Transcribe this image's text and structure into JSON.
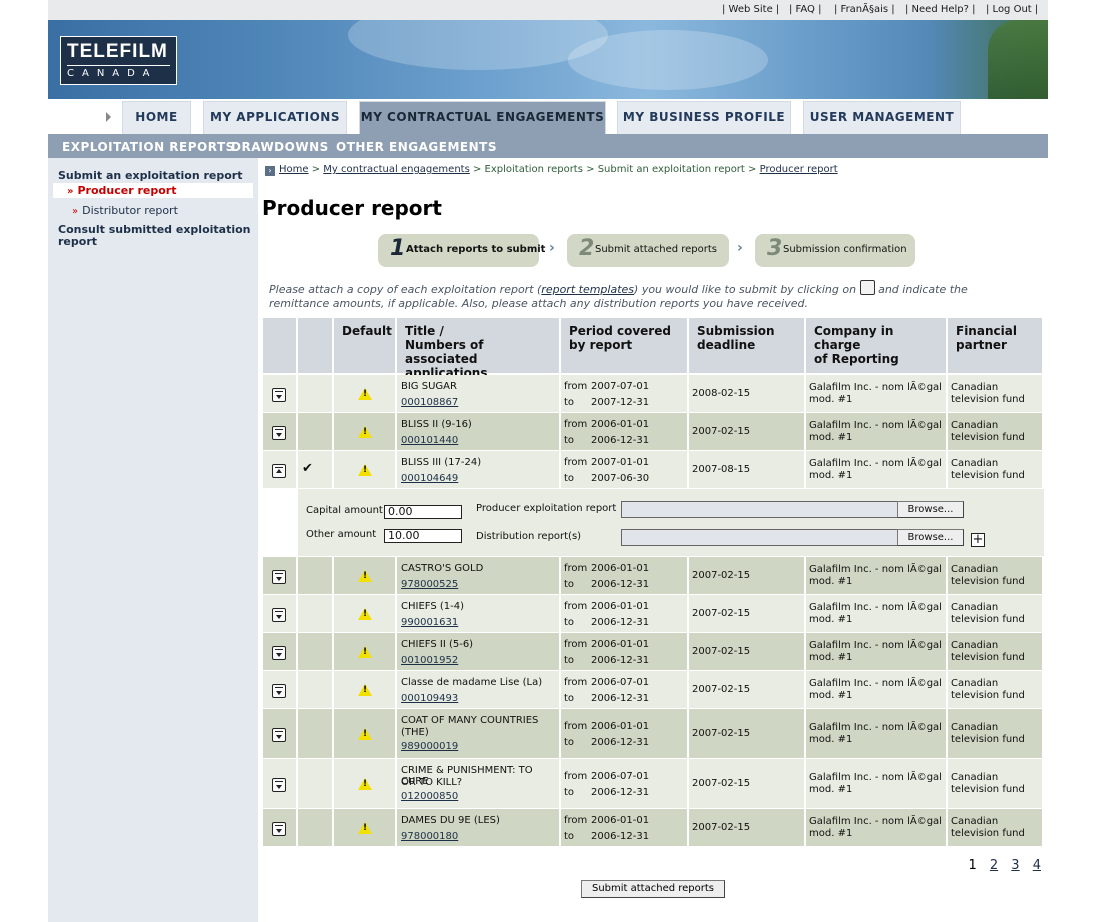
{
  "util_nav": {
    "web_site": "| Web Site |",
    "faq": "| FAQ |",
    "francais": "| FranÃ§ais |",
    "need_help": "| Need Help? |",
    "log_out": "| Log Out |"
  },
  "logo": {
    "line1": "TELEFILM",
    "line2": "CANADA"
  },
  "main_nav": {
    "home": "HOME",
    "my_applications": "MY APPLICATIONS",
    "my_contractual_engagements": "MY CONTRACTUAL ENGAGEMENTS",
    "my_business_profile": "MY BUSINESS PROFILE",
    "user_management": "USER MANAGEMENT",
    "active": "MY CONTRACTUAL ENGAGEMENTS"
  },
  "sub_nav": {
    "exploitation_reports": "EXPLOITATION REPORTS",
    "drawdowns": "DRAWDOWNS",
    "other_engagements": "OTHER ENGAGEMENTS"
  },
  "sidebar": {
    "submit_heading": "Submit an exploitation report",
    "producer_report": "Producer report",
    "distributor_report": "Distributor report",
    "consult_line1": "Consult submitted exploitation",
    "consult_line2": "report",
    "marker": "»"
  },
  "breadcrumb": {
    "home": "Home",
    "sep": " > ",
    "contractual": "My contractual engagements",
    "exploitation": "Exploitation reports",
    "submit": "Submit an exploitation report",
    "producer": "Producer report"
  },
  "page_title": "Producer report",
  "steps": [
    {
      "num": "1",
      "label": "Attach reports to submit"
    },
    {
      "num": "2",
      "label": "Submit attached reports"
    },
    {
      "num": "3",
      "label": "Submission confirmation"
    }
  ],
  "step_separator": "›",
  "intro": {
    "part1": "Please attach a copy of each exploitation report (",
    "link": "report templates",
    "part2": ") you would like to submit by clicking on",
    "part3": "and indicate the",
    "line2": "remittance amounts, if applicable. Also, please attach any distribution reports you have received."
  },
  "columns": {
    "default": "Default",
    "title_l1": "Title /",
    "title_l2": "Numbers of associated",
    "title_l3": "applications",
    "period_l1": "Period covered",
    "period_l2": "by report",
    "deadline_l1": "Submission",
    "deadline_l2": "deadline",
    "company_l1": "Company in charge",
    "company_l2": "of Reporting",
    "partner_l1": "Financial",
    "partner_l2": "partner"
  },
  "labels": {
    "from": "from",
    "to": "to",
    "warn_glyph": "!",
    "check_glyph": "✔"
  },
  "rows": [
    {
      "title": "BIG SUGAR",
      "app": "000108867",
      "from": "2007-07-01",
      "to": "2007-12-31",
      "deadline": "2008-02-15",
      "company_l1": "Galafilm Inc. - nom lÃ©gal",
      "company_l2": "mod. #1",
      "partner_l1": "Canadian",
      "partner_l2": "television fund"
    },
    {
      "title": "BLISS II (9-16)",
      "app": "000101440",
      "from": "2006-01-01",
      "to": "2006-12-31",
      "deadline": "2007-02-15",
      "company_l1": "Galafilm Inc. - nom lÃ©gal",
      "company_l2": "mod. #1",
      "partner_l1": "Canadian",
      "partner_l2": "television fund"
    },
    {
      "title": "BLISS III (17-24)",
      "app": "000104649",
      "from": "2007-01-01",
      "to": "2007-06-30",
      "deadline": "2007-08-15",
      "company_l1": "Galafilm Inc. - nom lÃ©gal",
      "company_l2": "mod. #1",
      "partner_l1": "Canadian",
      "partner_l2": "television fund"
    },
    {
      "title": "CASTRO'S GOLD",
      "app": "978000525",
      "from": "2006-01-01",
      "to": "2006-12-31",
      "deadline": "2007-02-15",
      "company_l1": "Galafilm Inc. - nom lÃ©gal",
      "company_l2": "mod. #1",
      "partner_l1": "Canadian",
      "partner_l2": "television fund"
    },
    {
      "title": "CHIEFS (1-4)",
      "app": "990001631",
      "from": "2006-01-01",
      "to": "2006-12-31",
      "deadline": "2007-02-15",
      "company_l1": "Galafilm Inc. - nom lÃ©gal",
      "company_l2": "mod. #1",
      "partner_l1": "Canadian",
      "partner_l2": "television fund"
    },
    {
      "title": "CHIEFS II (5-6)",
      "app": "001001952",
      "from": "2006-01-01",
      "to": "2006-12-31",
      "deadline": "2007-02-15",
      "company_l1": "Galafilm Inc. - nom lÃ©gal",
      "company_l2": "mod. #1",
      "partner_l1": "Canadian",
      "partner_l2": "television fund"
    },
    {
      "title": "Classe de madame Lise (La)",
      "app": "000109493",
      "from": "2006-07-01",
      "to": "2006-12-31",
      "deadline": "2007-02-15",
      "company_l1": "Galafilm Inc. - nom lÃ©gal",
      "company_l2": "mod. #1",
      "partner_l1": "Canadian",
      "partner_l2": "television fund"
    },
    {
      "title_l1": "COAT OF MANY COUNTRIES",
      "title_l2": "(THE)",
      "app": "989000019",
      "from": "2006-01-01",
      "to": "2006-12-31",
      "deadline": "2007-02-15",
      "company_l1": "Galafilm Inc. - nom lÃ©gal",
      "company_l2": "mod. #1",
      "partner_l1": "Canadian",
      "partner_l2": "television fund"
    },
    {
      "title_l1": "CRIME & PUNISHMENT: TO CURE",
      "title_l2": "OR TO KILL?",
      "app": "012000850",
      "from": "2006-07-01",
      "to": "2006-12-31",
      "deadline": "2007-02-15",
      "company_l1": "Galafilm Inc. - nom lÃ©gal",
      "company_l2": "mod. #1",
      "partner_l1": "Canadian",
      "partner_l2": "television fund"
    },
    {
      "title": "DAMES DU 9E (LES)",
      "app": "978000180",
      "from": "2006-01-01",
      "to": "2006-12-31",
      "deadline": "2007-02-15",
      "company_l1": "Galafilm Inc. - nom lÃ©gal",
      "company_l2": "mod. #1",
      "partner_l1": "Canadian",
      "partner_l2": "television fund"
    }
  ],
  "attach": {
    "capital_label": "Capital amount",
    "capital_value": "0.00",
    "other_label": "Other amount",
    "other_value": "10.00",
    "producer_report_label": "Producer exploitation report",
    "distribution_label": "Distribution report(s)",
    "browse": "Browse...",
    "plus": "+"
  },
  "pagination": {
    "current": "1",
    "p2": "2",
    "p3": "3",
    "p4": "4"
  },
  "submit_button": "Submit attached reports",
  "colors": {
    "nav_active": "#8e9fb3",
    "row_light": "#e8ece2",
    "row_dark": "#cfd6c3",
    "header": "#d3d8de",
    "warn": "#f2e100"
  }
}
